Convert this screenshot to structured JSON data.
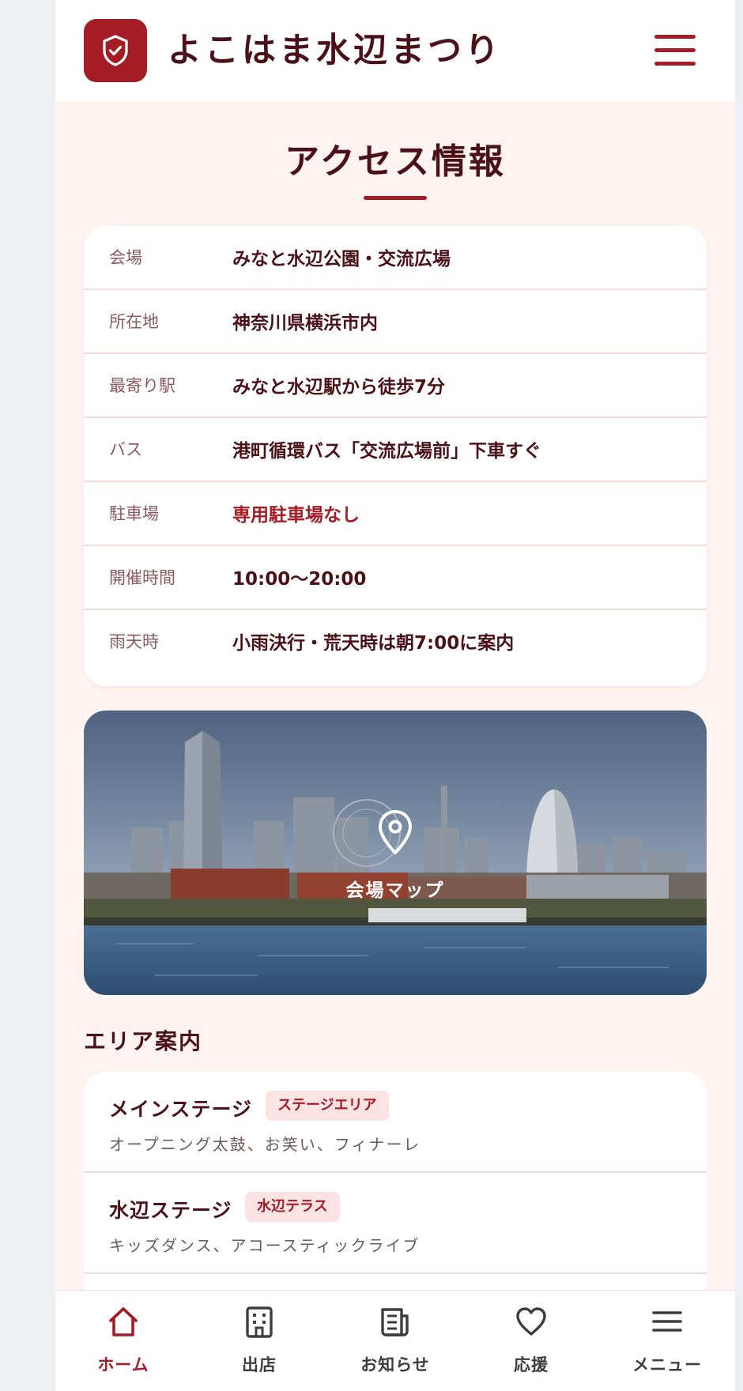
{
  "header": {
    "site_title": "よこはま水辺まつり"
  },
  "access": {
    "title": "アクセス情報",
    "rows": [
      {
        "label": "会場",
        "value": "みなと水辺公園・交流広場"
      },
      {
        "label": "所在地",
        "value": "神奈川県横浜市内"
      },
      {
        "label": "最寄り駅",
        "value": "みなと水辺駅から徒歩7分"
      },
      {
        "label": "バス",
        "value": "港町循環バス「交流広場前」下車すぐ"
      },
      {
        "label": "駐車場",
        "value": "専用駐車場なし"
      },
      {
        "label": "開催時間",
        "value": "10:00〜20:00"
      },
      {
        "label": "雨天時",
        "value": "小雨決行・荒天時は朝7:00に案内"
      }
    ]
  },
  "map": {
    "label": "会場マップ"
  },
  "areas": {
    "heading": "エリア案内",
    "items": [
      {
        "name": "メインステージ",
        "tag": "ステージエリア",
        "desc": "オープニング太鼓、お笑い、フィナーレ"
      },
      {
        "name": "水辺ステージ",
        "tag": "水辺テラス",
        "desc": "キッズダンス、アコースティックライブ"
      }
    ]
  },
  "nav": {
    "items": [
      {
        "label": "ホーム",
        "icon": "home-icon",
        "active": true
      },
      {
        "label": "出店",
        "icon": "building-icon",
        "active": false
      },
      {
        "label": "お知らせ",
        "icon": "news-icon",
        "active": false
      },
      {
        "label": "応援",
        "icon": "heart-icon",
        "active": false
      },
      {
        "label": "メニュー",
        "icon": "menu-icon",
        "active": false
      }
    ]
  },
  "colors": {
    "accent": "#a41c26",
    "text": "#4a1218",
    "background": "#fdf4f2"
  }
}
